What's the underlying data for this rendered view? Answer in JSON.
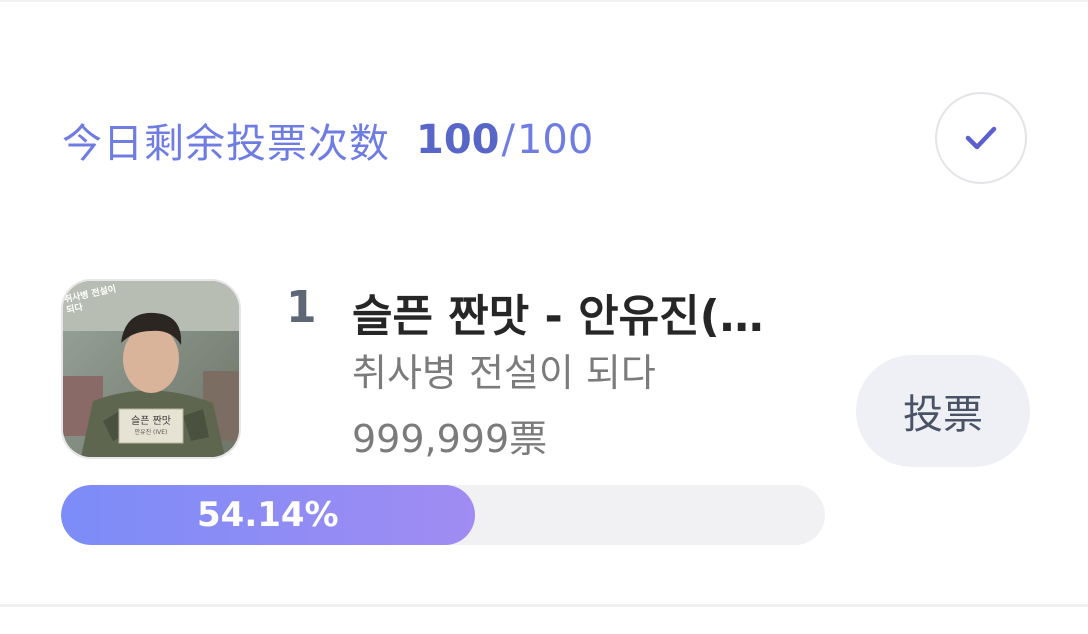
{
  "header": {
    "votes_label": "今日剩余投票次数",
    "votes_current": "100",
    "votes_separator": "/",
    "votes_total": "100",
    "confirm_icon": "check-icon"
  },
  "entry": {
    "rank": "1",
    "title": "슬픈 짠맛 - 안유진(…",
    "subtitle": "취사병 전설이 되다",
    "vote_count": "999,999票",
    "vote_button_label": "投票",
    "percentage_label": "54.14%",
    "percentage": 54.14
  },
  "album_art": {
    "cover_text_top": "취사병 전설이 되다",
    "cover_text_badge": "슬픈 짠맛",
    "cover_text_artist": "안유진 (IVE)"
  },
  "colors": {
    "accent": "#6f7de3",
    "progress_start": "#7c8cf8",
    "progress_end": "#a08cf2",
    "vote_button_bg": "#eff0f5"
  }
}
